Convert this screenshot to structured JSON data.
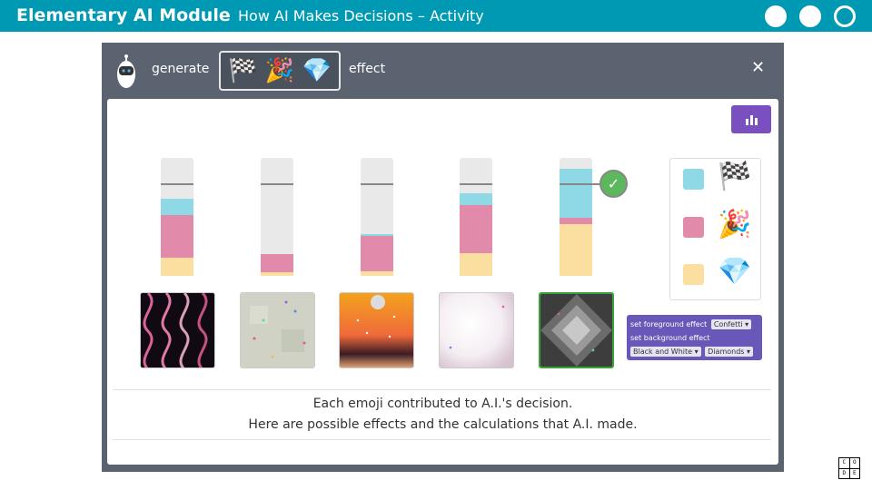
{
  "header": {
    "brand": "Elementary AI Module",
    "subtitle": "How AI Makes Decisions – Activity"
  },
  "window": {
    "generate_label": "generate",
    "effect_label": "effect",
    "selected_emojis": [
      "🏁",
      "🎉",
      "💎"
    ],
    "close_label": "✕"
  },
  "legend": [
    {
      "color": "#8fd8e6",
      "emoji": "🏁"
    },
    {
      "color": "#e18aaa",
      "emoji": "🎉"
    },
    {
      "color": "#fbdfa0",
      "emoji": "💎"
    }
  ],
  "check_label": "✓",
  "code_block": {
    "line1": "set foreground effect",
    "line1_value": "Confetti ▾",
    "line2": "set background effect",
    "line3_value_a": "Black and White ▾",
    "line3_value_b": "Diamonds ▾"
  },
  "caption": {
    "line1": "Each emoji contributed to A.I.'s decision.",
    "line2": "Here are possible effects and the calculations that A.I. made."
  },
  "code_logo": [
    "C",
    "O",
    "D",
    "E"
  ]
}
